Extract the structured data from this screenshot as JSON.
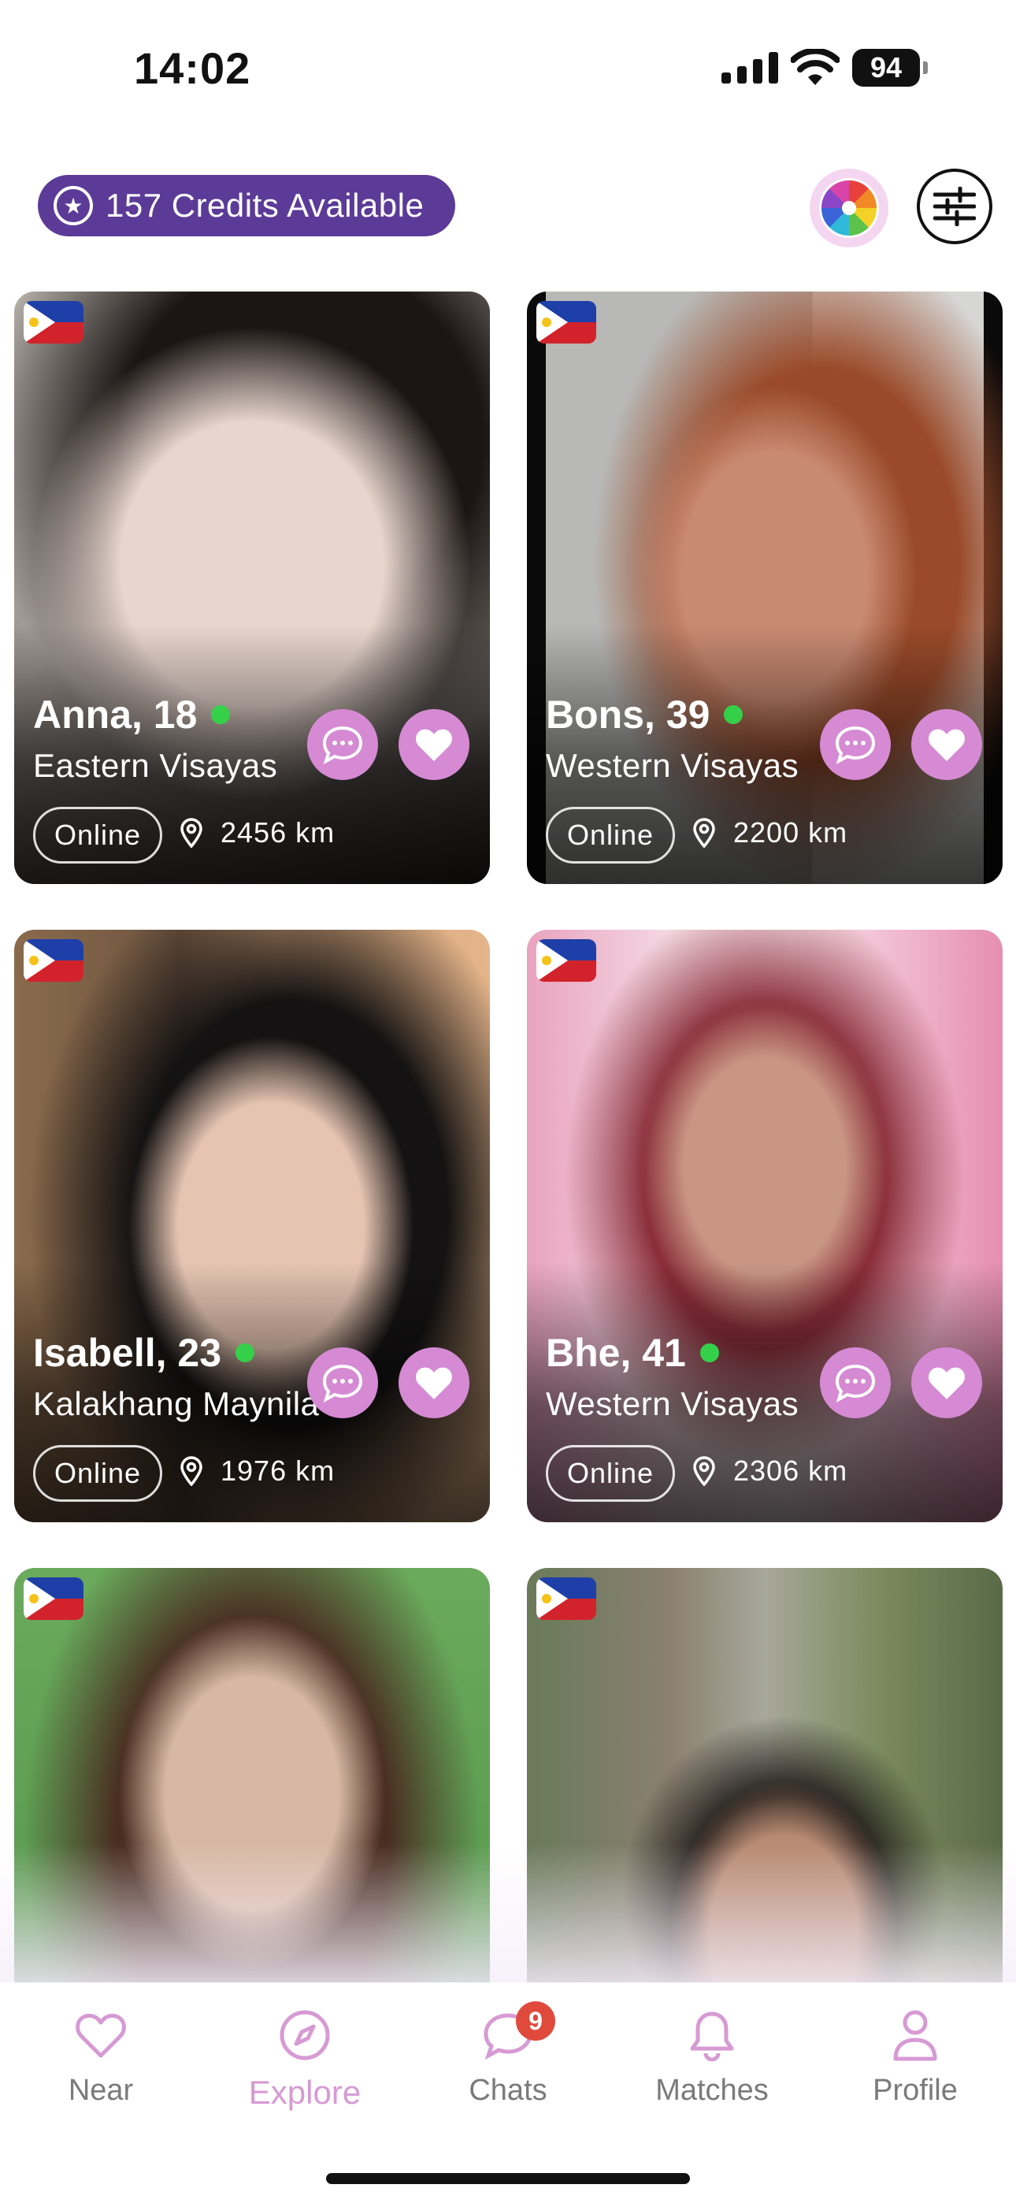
{
  "status_bar": {
    "time": "14:02",
    "battery": "94"
  },
  "header": {
    "credits_label": "157 Credits Available"
  },
  "profiles": [
    {
      "name_age": "Anna, 18",
      "region": "Eastern Visayas",
      "status": "Online",
      "distance": "2456 km",
      "online": true
    },
    {
      "name_age": "Bons, 39",
      "region": "Western Visayas",
      "status": "Online",
      "distance": "2200 km",
      "online": true
    },
    {
      "name_age": "Isabell, 23",
      "region": "Kalakhang Maynila",
      "status": "Online",
      "distance": "1976 km",
      "online": true
    },
    {
      "name_age": "Bhe, 41",
      "region": "Western Visayas",
      "status": "Online",
      "distance": "2306 km",
      "online": true
    },
    {
      "name_age": "",
      "region": "",
      "status": "",
      "distance": ""
    },
    {
      "name_age": "",
      "region": "",
      "status": "",
      "distance": ""
    }
  ],
  "tabs": [
    {
      "label": "Near",
      "icon": "heart-icon"
    },
    {
      "label": "Explore",
      "icon": "compass-icon",
      "active": true
    },
    {
      "label": "Chats",
      "icon": "chat-icon",
      "badge": "9"
    },
    {
      "label": "Matches",
      "icon": "bell-icon"
    },
    {
      "label": "Profile",
      "icon": "person-icon"
    }
  ],
  "colors": {
    "accent": "#d79ad4",
    "credits_bg": "#5b3b97",
    "online_dot": "#35d04a",
    "button_bg": "#d58ad3"
  }
}
